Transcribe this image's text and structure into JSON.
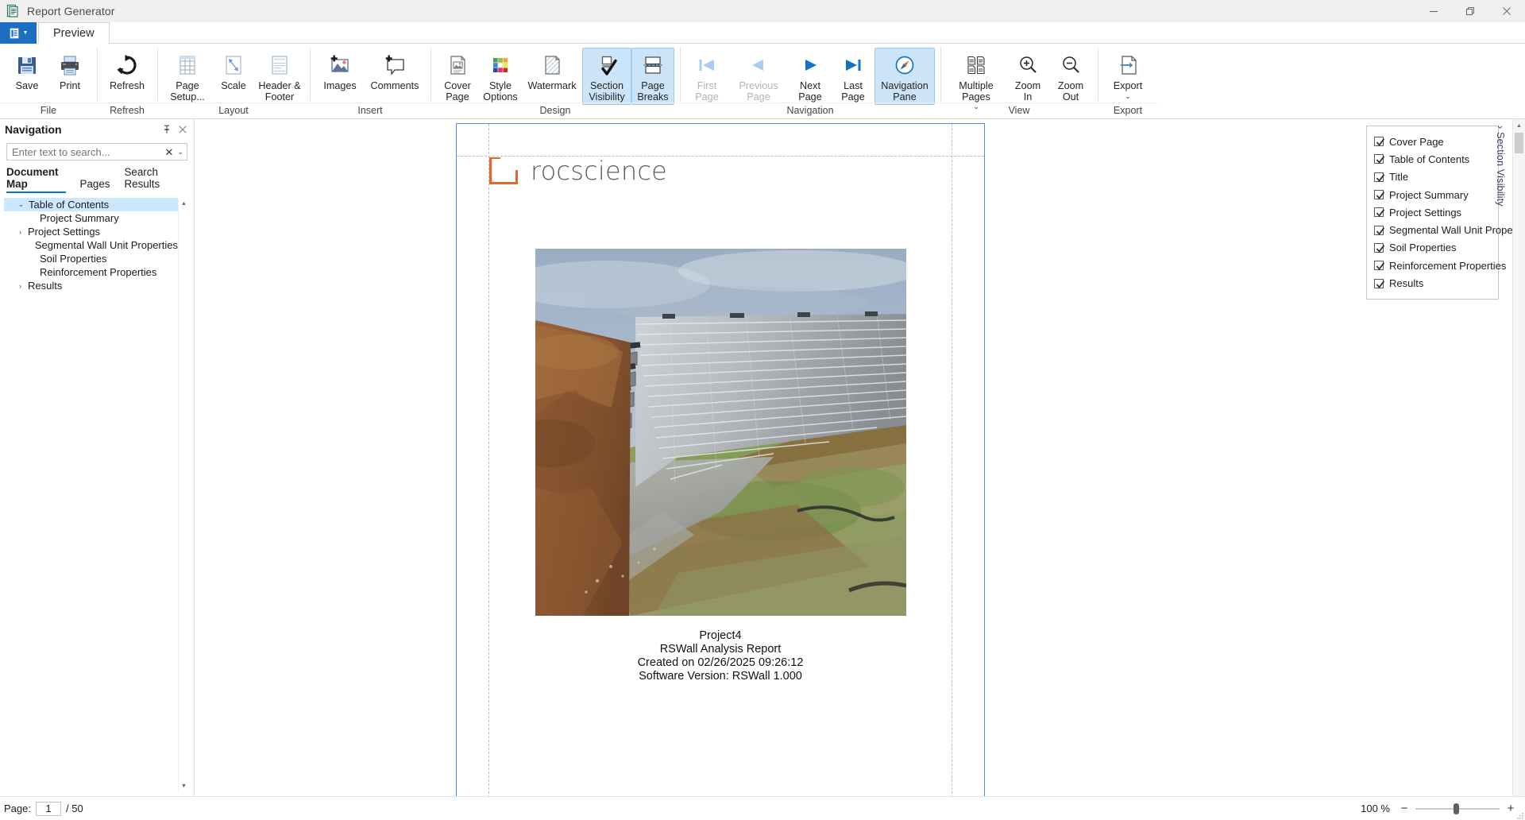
{
  "window": {
    "title": "Report Generator",
    "icon": "report-document-icon",
    "controls": {
      "minimize": "minimize-icon",
      "restore": "restore-icon",
      "close": "close-icon"
    }
  },
  "ribbon": {
    "file_menu_icon": "file-menu-icon",
    "tabs": [
      {
        "label": "Preview",
        "selected": true
      }
    ],
    "groups": [
      {
        "label": "File",
        "items": [
          {
            "label": "Save",
            "icon": "save-icon",
            "state": "normal"
          },
          {
            "label": "Print",
            "icon": "print-icon",
            "state": "normal"
          }
        ]
      },
      {
        "label": "Refresh",
        "items": [
          {
            "label": "Refresh",
            "icon": "refresh-icon",
            "state": "normal"
          }
        ]
      },
      {
        "label": "Layout",
        "items": [
          {
            "label": "Page Setup...",
            "icon": "page-setup-icon",
            "state": "normal"
          },
          {
            "label": "Scale",
            "icon": "scale-icon",
            "state": "normal"
          },
          {
            "label": "Header & Footer",
            "icon": "header-footer-icon",
            "state": "normal"
          }
        ]
      },
      {
        "label": "Insert",
        "items": [
          {
            "label": "Images",
            "icon": "images-icon",
            "state": "normal"
          },
          {
            "label": "Comments",
            "icon": "comments-icon",
            "state": "normal"
          }
        ]
      },
      {
        "label": "Design",
        "items": [
          {
            "label": "Cover Page",
            "icon": "cover-page-icon",
            "state": "normal"
          },
          {
            "label": "Style Options",
            "icon": "style-options-icon",
            "state": "normal"
          },
          {
            "label": "Watermark",
            "icon": "watermark-icon",
            "state": "normal"
          },
          {
            "label": "Section Visibility",
            "icon": "section-visibility-icon",
            "state": "active"
          },
          {
            "label": "Page Breaks",
            "icon": "page-breaks-icon",
            "state": "active"
          }
        ]
      },
      {
        "label": "Navigation",
        "items": [
          {
            "label": "First Page",
            "icon": "first-page-icon",
            "state": "disabled"
          },
          {
            "label": "Previous Page",
            "icon": "previous-page-icon",
            "state": "disabled"
          },
          {
            "label": "Next Page",
            "icon": "next-page-icon",
            "state": "normal"
          },
          {
            "label": "Last Page",
            "icon": "last-page-icon",
            "state": "normal"
          },
          {
            "label": "Navigation Pane",
            "icon": "navigation-pane-icon",
            "state": "active"
          }
        ]
      },
      {
        "label": "View",
        "items": [
          {
            "label": "Multiple Pages",
            "icon": "multiple-pages-icon",
            "state": "normal",
            "dropdown": true
          },
          {
            "label": "Zoom In",
            "icon": "zoom-in-icon",
            "state": "normal"
          },
          {
            "label": "Zoom Out",
            "icon": "zoom-out-icon",
            "state": "normal"
          }
        ]
      },
      {
        "label": "Export",
        "items": [
          {
            "label": "Export",
            "icon": "export-icon",
            "state": "normal",
            "dropdown": true
          }
        ]
      }
    ]
  },
  "navigation": {
    "title": "Navigation",
    "pin_icon": "pin-icon",
    "close_icon": "close-icon",
    "search": {
      "placeholder": "Enter text to search...",
      "value": "",
      "clear_icon": "clear-icon",
      "dropdown_icon": "chevron-down-icon"
    },
    "tabs": [
      {
        "label": "Document Map",
        "selected": true
      },
      {
        "label": "Pages",
        "selected": false
      },
      {
        "label": "Search Results",
        "selected": false
      }
    ],
    "tree": [
      {
        "label": "Table of Contents",
        "level": 0,
        "expander": "expanded",
        "selected": true
      },
      {
        "label": "Project Summary",
        "level": 1,
        "expander": "none",
        "selected": false
      },
      {
        "label": "Project Settings",
        "level": 1,
        "expander": "collapsed",
        "selected": false
      },
      {
        "label": "Segmental Wall Unit Properties",
        "level": 1,
        "expander": "none",
        "selected": false
      },
      {
        "label": "Soil Properties",
        "level": 1,
        "expander": "none",
        "selected": false
      },
      {
        "label": "Reinforcement Properties",
        "level": 1,
        "expander": "none",
        "selected": false
      },
      {
        "label": "Results",
        "level": 1,
        "expander": "collapsed",
        "selected": false
      }
    ]
  },
  "document": {
    "logo_text": "rocscience",
    "logo_color": "#e8642a",
    "photo_alt": "segmental-retaining-wall-photo",
    "cover_lines": [
      "Project4",
      "RSWall Analysis Report",
      "Created on 02/26/2025 09:26:12",
      "Software Version: RSWall 1.000"
    ]
  },
  "section_visibility": {
    "tab_label": "Section Visibility",
    "tab_chevron": "chevron-left-icon",
    "items": [
      {
        "label": "Cover Page",
        "checked": true
      },
      {
        "label": "Table of Contents",
        "checked": true
      },
      {
        "label": "Title",
        "checked": true
      },
      {
        "label": "Project Summary",
        "checked": true
      },
      {
        "label": "Project Settings",
        "checked": true
      },
      {
        "label": "Segmental Wall Unit Properties",
        "checked": true
      },
      {
        "label": "Soil Properties",
        "checked": true
      },
      {
        "label": "Reinforcement Properties",
        "checked": true
      },
      {
        "label": "Results",
        "checked": true
      }
    ]
  },
  "statusbar": {
    "page_label": "Page:",
    "page_value": "1",
    "page_total": "/ 50",
    "zoom_percent": "100 %",
    "zoom_out_label": "−",
    "zoom_in_label": "+"
  }
}
